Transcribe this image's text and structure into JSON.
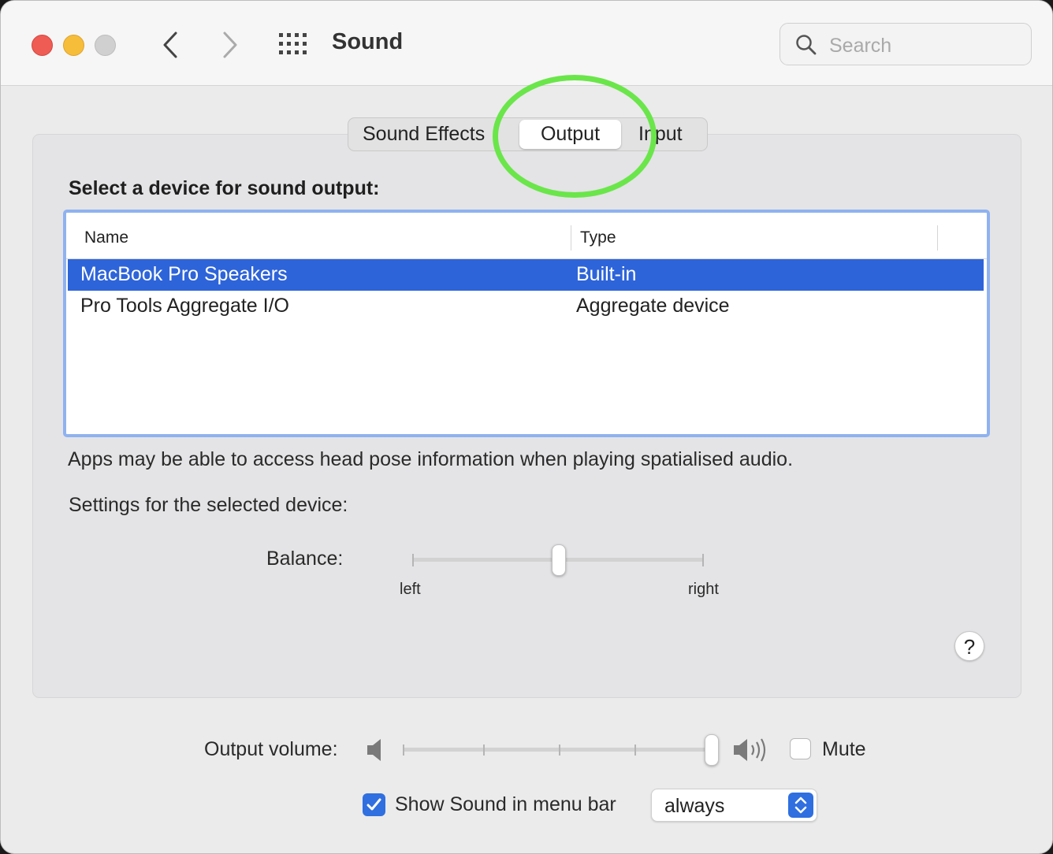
{
  "window": {
    "title": "Sound",
    "search": {
      "placeholder": "Search",
      "value": ""
    }
  },
  "tabs": [
    {
      "label": "Sound Effects",
      "selected": false
    },
    {
      "label": "Output",
      "selected": true
    },
    {
      "label": "Input",
      "selected": false
    }
  ],
  "output": {
    "section_label": "Select a device for sound output:",
    "columns": [
      "Name",
      "Type"
    ],
    "devices": [
      {
        "name": "MacBook Pro Speakers",
        "type": "Built-in",
        "selected": true
      },
      {
        "name": "Pro Tools Aggregate I/O",
        "type": "Aggregate device",
        "selected": false
      }
    ],
    "info_text": "Apps may be able to access head pose information when playing spatialised audio.",
    "settings_label": "Settings for the selected device:",
    "balance": {
      "label": "Balance:",
      "left_label": "left",
      "right_label": "right",
      "value": 0.5
    },
    "help": "?"
  },
  "footer": {
    "volume_label": "Output volume:",
    "volume_value": 1.0,
    "mute_label": "Mute",
    "mute_checked": false,
    "show_menu_label": "Show Sound in menu bar",
    "show_menu_checked": true,
    "show_menu_option": "always"
  },
  "colors": {
    "selection": "#2e64d9",
    "accent": "#2f6fe0",
    "highlight": "#6ae64a"
  }
}
